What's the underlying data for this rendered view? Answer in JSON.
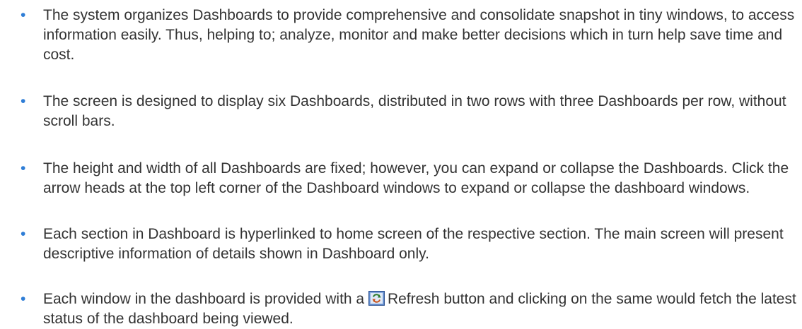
{
  "bullets": [
    {
      "text": "The system organizes Dashboards to provide comprehensive and consolidate snapshot in tiny windows, to access information easily. Thus, helping to; analyze, monitor and make better decisions which in turn help save time and cost."
    },
    {
      "text": "The screen is designed to display six Dashboards, distributed in two rows with three Dashboards per row, without scroll bars."
    },
    {
      "text": "The height and width of all Dashboards are fixed; however, you can expand or collapse the Dashboards. Click the arrow heads at the top left corner of the Dashboard windows to expand or collapse the dashboard windows."
    },
    {
      "text": "Each section in Dashboard is hyperlinked to home screen of the respective section. The main screen will present descriptive information of details shown in Dashboard only."
    },
    {
      "text_before": "Each window in the dashboard is provided with a",
      "icon": "refresh-icon",
      "text_after": "Refresh button and clicking on the same would fetch the latest status of the dashboard being viewed."
    }
  ]
}
